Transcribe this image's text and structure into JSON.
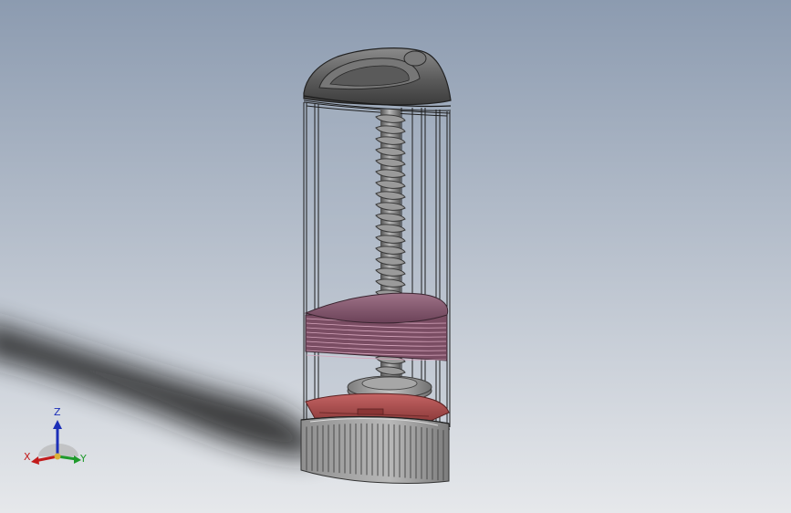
{
  "viewport": {
    "background_top": "#8c9bb0",
    "background_bottom": "#e6e8eb"
  },
  "model": {
    "parts": [
      "cap-top",
      "clear-body",
      "lead-screw",
      "pusher-plate",
      "stack-disks",
      "drive-gear",
      "grip-base"
    ],
    "colors": {
      "cap": "#6e6e6e",
      "screw": "#8a8a8a",
      "plate": "#8a5d74",
      "gear": "#b55050",
      "base": "#9a9a9a",
      "body_edges": "#1e1e1e"
    }
  },
  "triad": {
    "x_label": "X",
    "y_label": "Y",
    "z_label": "Z",
    "x_color": "#c21b1b",
    "y_color": "#1f9a2c",
    "z_color": "#1c2fb8"
  }
}
